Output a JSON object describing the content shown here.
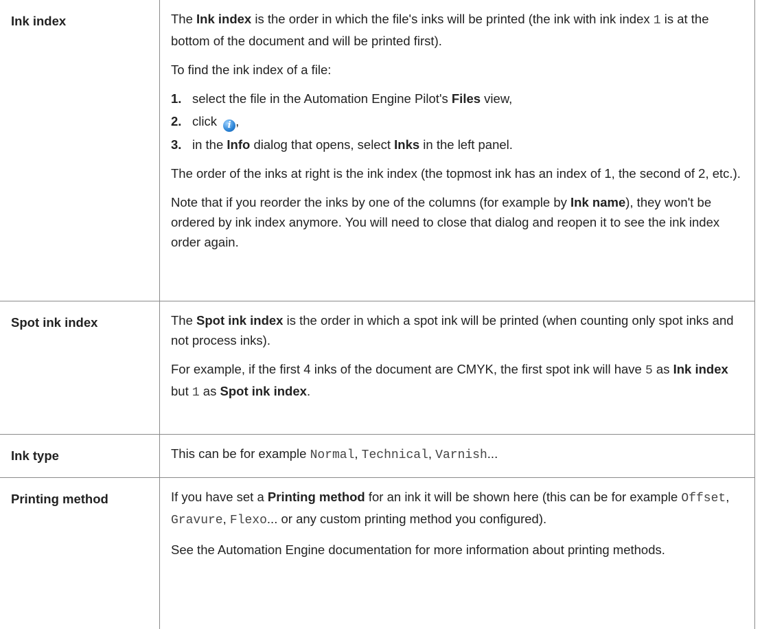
{
  "rows": [
    {
      "label": "Ink index",
      "p1": {
        "a": "The ",
        "b": "Ink index",
        "c": " is the order in which the file's inks will be printed (the ink with ink index ",
        "code": "1",
        "d": " is at the bottom of the document and will be printed first)."
      },
      "p2": "To find the ink index of a file:",
      "steps": [
        {
          "num": "1.",
          "a": "select the file in the Automation Engine Pilot's ",
          "b": "Files",
          "c": " view,"
        },
        {
          "num": "2.",
          "a": "click ",
          "icon": "info-icon",
          "c": ","
        },
        {
          "num": "3.",
          "a": "in the ",
          "b": "Info",
          "c": " dialog that opens, select ",
          "d": "Inks",
          "e": " in the left panel."
        }
      ],
      "p3": "The order of the inks at right is the ink index (the topmost ink has an index of 1, the second of 2, etc.).",
      "p4": {
        "a": "Note that if you reorder the inks by one of the columns (for example by ",
        "b": "Ink name",
        "c": "), they won't be ordered by ink index anymore. You will need to close that dialog and reopen it to see the ink index order again."
      }
    },
    {
      "label": "Spot ink index",
      "p1": {
        "a": "The ",
        "b": "Spot ink index",
        "c": " is the order in which a spot ink will be printed (when counting only spot inks and not process inks)."
      },
      "p2": {
        "a": "For example, if the first 4 inks of the document are CMYK, the first spot ink will have ",
        "code1": "5",
        "b": " as ",
        "c": "Ink index",
        "d": " but ",
        "code2": "1",
        "e": " as ",
        "f": "Spot ink index",
        "g": "."
      }
    },
    {
      "label": "Ink type",
      "p1": {
        "a": "This can be for example ",
        "code1": "Normal",
        "sep1": ", ",
        "code2": "Technical",
        "sep2": ", ",
        "code3": "Varnish",
        "end": "..."
      }
    },
    {
      "label": "Printing method",
      "p1": {
        "a": "If you have set a ",
        "b": "Printing method",
        "c": " for an ink it will be shown here (this can be for example ",
        "code1": "Offset",
        "sep1": ", ",
        "code2": "Gravure",
        "sep2": ", ",
        "code3": "Flexo",
        "d": "... or any custom printing method you configured)."
      },
      "p2": "See the Automation Engine documentation for more information about printing methods."
    }
  ]
}
